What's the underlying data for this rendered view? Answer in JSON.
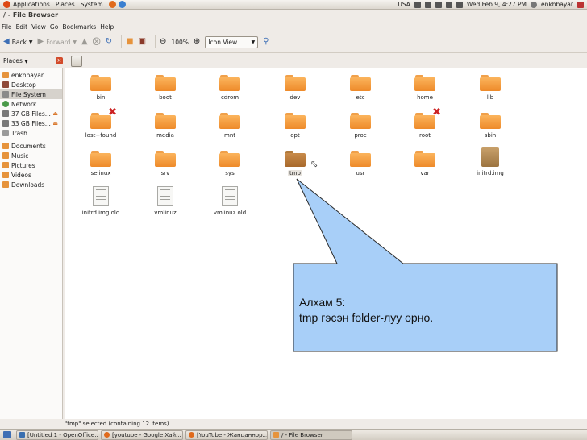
{
  "top_panel": {
    "menus": [
      "Applications",
      "Places",
      "System"
    ],
    "keyboard_layout": "USA",
    "datetime": "Wed Feb  9,  4:27 PM",
    "username": "enkhbayar"
  },
  "window": {
    "title": "/ - File Browser"
  },
  "menubar": {
    "items": [
      "File",
      "Edit",
      "View",
      "Go",
      "Bookmarks",
      "Help"
    ]
  },
  "toolbar": {
    "back_label": "Back",
    "forward_label": "Forward",
    "zoom_level": "100%",
    "view_mode": "Icon View"
  },
  "sidebar": {
    "header": "Places",
    "items": [
      {
        "label": "enkhbayar",
        "icon": "home-folder-icon",
        "color": "#e6933c"
      },
      {
        "label": "Desktop",
        "icon": "desktop-icon",
        "color": "#8f4a3a"
      },
      {
        "label": "File System",
        "icon": "harddisk-icon",
        "color": "#8a8a8a"
      },
      {
        "label": "Network",
        "icon": "network-icon",
        "color": "#4a9a4a"
      },
      {
        "label": "37 GB Files...",
        "icon": "drive-icon",
        "color": "#7a7a7a"
      },
      {
        "label": "33 GB Files...",
        "icon": "drive-icon",
        "color": "#7a7a7a"
      },
      {
        "label": "Trash",
        "icon": "trash-icon",
        "color": "#9a9a9a"
      },
      {
        "label": "Documents",
        "icon": "documents-folder-icon",
        "color": "#e6933c"
      },
      {
        "label": "Music",
        "icon": "music-folder-icon",
        "color": "#e6933c"
      },
      {
        "label": "Pictures",
        "icon": "pictures-folder-icon",
        "color": "#e6933c"
      },
      {
        "label": "Videos",
        "icon": "videos-folder-icon",
        "color": "#e6933c"
      },
      {
        "label": "Downloads",
        "icon": "downloads-folder-icon",
        "color": "#e6933c"
      }
    ]
  },
  "files": [
    {
      "name": "bin",
      "kind": "folder"
    },
    {
      "name": "boot",
      "kind": "folder"
    },
    {
      "name": "cdrom",
      "kind": "folder"
    },
    {
      "name": "dev",
      "kind": "folder"
    },
    {
      "name": "etc",
      "kind": "folder"
    },
    {
      "name": "home",
      "kind": "folder"
    },
    {
      "name": "lib",
      "kind": "folder"
    },
    {
      "name": "lost+found",
      "kind": "folder-locked"
    },
    {
      "name": "media",
      "kind": "folder"
    },
    {
      "name": "mnt",
      "kind": "folder"
    },
    {
      "name": "opt",
      "kind": "folder"
    },
    {
      "name": "proc",
      "kind": "folder"
    },
    {
      "name": "root",
      "kind": "folder-locked"
    },
    {
      "name": "sbin",
      "kind": "folder"
    },
    {
      "name": "selinux",
      "kind": "folder"
    },
    {
      "name": "srv",
      "kind": "folder"
    },
    {
      "name": "sys",
      "kind": "folder"
    },
    {
      "name": "tmp",
      "kind": "folder-selected"
    },
    {
      "name": "usr",
      "kind": "folder"
    },
    {
      "name": "var",
      "kind": "folder"
    },
    {
      "name": "initrd.img",
      "kind": "package"
    },
    {
      "name": "initrd.img.old",
      "kind": "document"
    },
    {
      "name": "vmlinuz",
      "kind": "document"
    },
    {
      "name": "vmlinuz.old",
      "kind": "document"
    }
  ],
  "callout": {
    "line1": "Алхам 5:",
    "line2": "tmp гэсэн folder-луу орно.",
    "fill_color": "#a8cff8"
  },
  "statusbar": {
    "text": "\"tmp\" selected (containing 12 items)"
  },
  "taskbar": {
    "tasks": [
      {
        "label": "[Untitled 1 - OpenOffice...",
        "icon_color": "#3a6fb0"
      },
      {
        "label": "[youtube - Google Хай...",
        "icon_color": "#e06a1c"
      },
      {
        "label": "[YouTube - Жанцаннор...",
        "icon_color": "#e06a1c"
      },
      {
        "label": "/ - File Browser",
        "icon_color": "#e6933c"
      }
    ]
  }
}
